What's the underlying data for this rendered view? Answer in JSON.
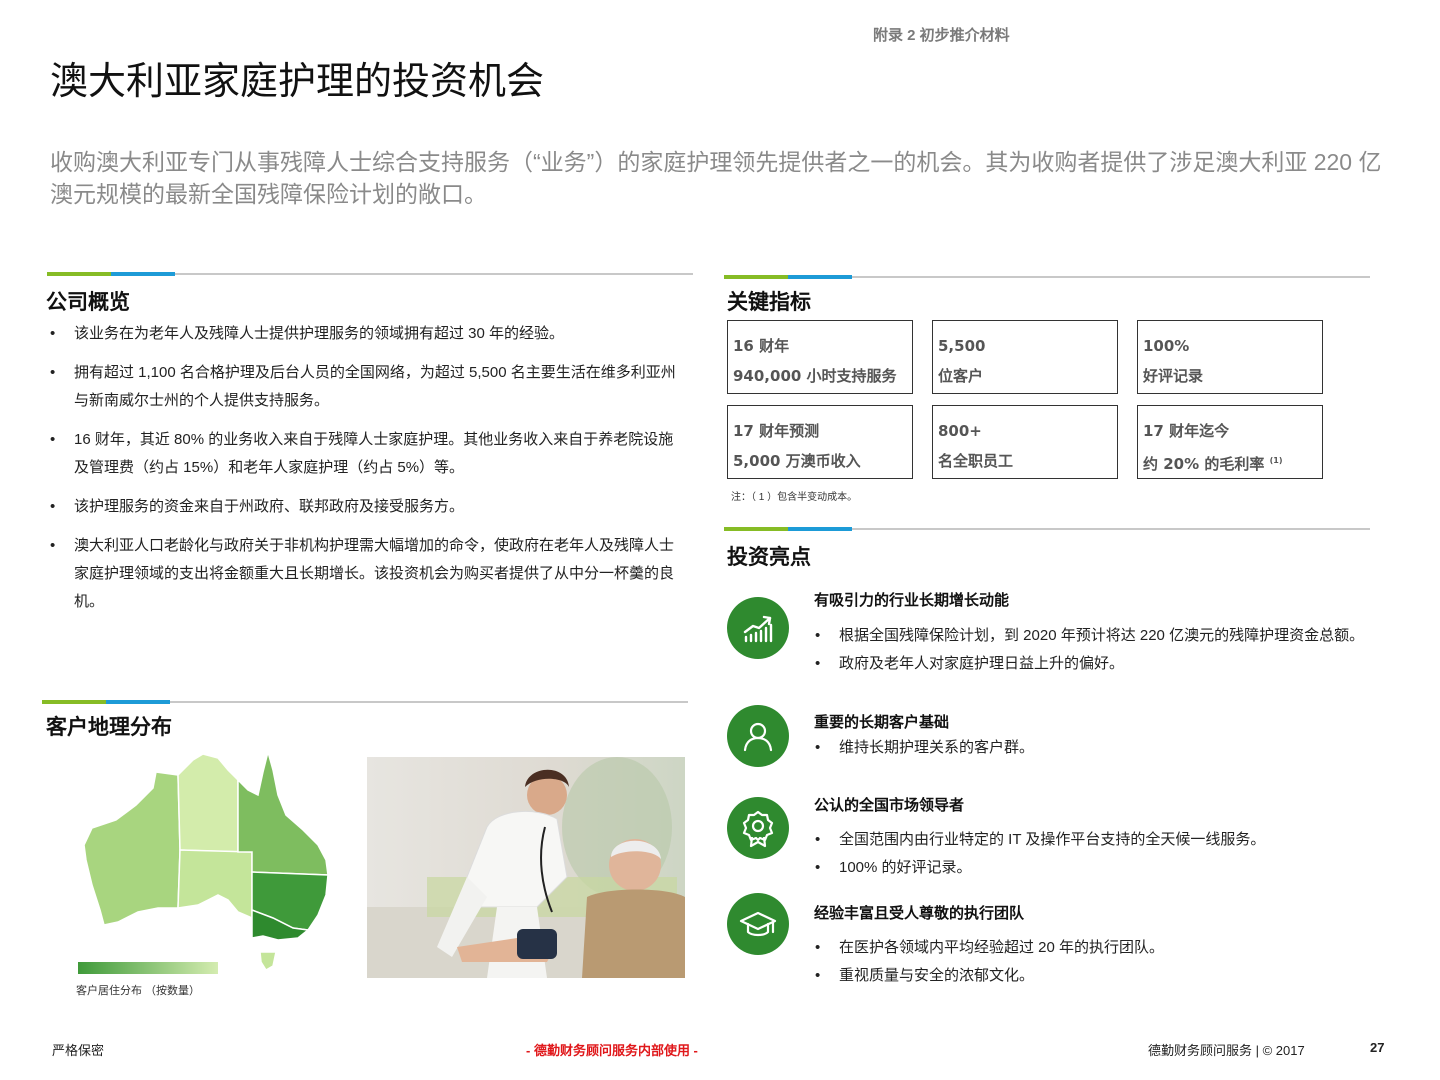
{
  "header": {
    "appendix_label": "附录 2 初步推介材料",
    "title": "澳大利亚家庭护理的投资机会",
    "subtitle": "收购澳大利亚专门从事残障人士综合支持服务（“业务”）的家庭护理领先提供者之一的机会。其为收购者提供了涉足澳大利亚 220 亿澳元规模的最新全国残障保险计划的敞口。"
  },
  "overview": {
    "title": "公司概览",
    "items": [
      "该业务在为老年人及残障人士提供护理服务的领域拥有超过 30 年的经验。",
      "拥有超过 1,100 名合格护理及后台人员的全国网络，为超过 5,500 名主要生活在维多利亚州与新南威尔士州的个人提供支持服务。",
      "16 财年，其近 80% 的业务收入来自于残障人士家庭护理。其他业务收入来自于养老院设施及管理费（约占 15%）和老年人家庭护理（约占 5%）等。",
      "该护理服务的资金来自于州政府、联邦政府及接受服务方。",
      "澳大利亚人口老龄化与政府关于非机构护理需大幅增加的命令，使政府在老年人及残障人士家庭护理领域的支出将金额重大且长期增长。该投资机会为购买者提供了从中分一杯羹的良机。"
    ]
  },
  "metrics": {
    "title": "关键指标",
    "boxes": [
      {
        "line1": "16 财年",
        "line2": "940,000 小时支持服务",
        "sup": ""
      },
      {
        "line1": "5,500",
        "line2": "位客户",
        "sup": ""
      },
      {
        "line1": "100%",
        "line2": "好评记录",
        "sup": ""
      },
      {
        "line1": "17 财年预测",
        "line2": "5,000 万澳币收入",
        "sup": ""
      },
      {
        "line1": "800+",
        "line2": "名全职员工",
        "sup": ""
      },
      {
        "line1": "17 财年迄今",
        "line2": "约 20% 的毛利率",
        "sup": "(1)"
      }
    ],
    "note": "注：（ 1 ）包含半变动成本。"
  },
  "highlights": {
    "title": "投资亮点",
    "items": [
      {
        "icon": "growth-chart-icon",
        "title": "有吸引力的行业长期增长动能",
        "bullets": [
          "根据全国残障保险计划，到 2020 年预计将达 220 亿澳元的残障护理资金总额。",
          "政府及老年人对家庭护理日益上升的偏好。"
        ]
      },
      {
        "icon": "person-icon",
        "title": "重要的长期客户基础",
        "bullets": [
          "维持长期护理关系的客户群。"
        ]
      },
      {
        "icon": "award-badge-icon",
        "title": "公认的全国市场领导者",
        "bullets": [
          "全国范围内由行业特定的 IT 及操作平台支持的全天候一线服务。",
          "100% 的好评记录。"
        ]
      },
      {
        "icon": "graduation-cap-icon",
        "title": "经验丰富且受人尊敬的执行团队",
        "bullets": [
          "在医护各领域内平均经验超过 20 年的执行团队。",
          "重视质量与安全的浓郁文化。"
        ]
      }
    ]
  },
  "geography": {
    "title": "客户地理分布",
    "legend_label": "客户居住分布 （按数量）",
    "colors": {
      "wa": "#a8d57f",
      "nt": "#d3ecab",
      "sa": "#c4e59a",
      "qld": "#7ebd5f",
      "nsw": "#3f9a3a",
      "vic": "#2e8a2e",
      "tas": "#c4e59a"
    }
  },
  "footer": {
    "confidential": "严格保密",
    "internal": "-  德勤财务顾问服务内部使用  -",
    "company": "德勤财务顾问服务 | © 2017",
    "page": "27"
  }
}
